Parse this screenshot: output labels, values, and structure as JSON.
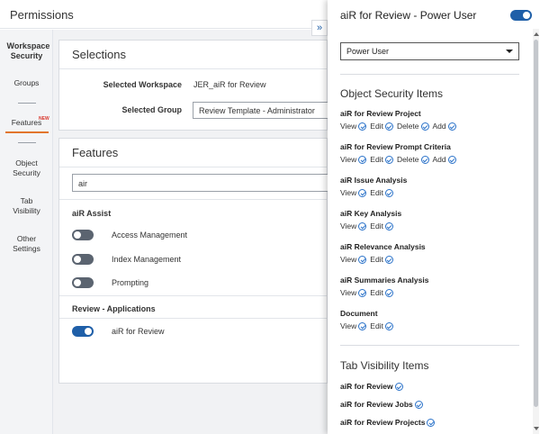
{
  "app": {
    "title": "Permissions"
  },
  "nav": {
    "workspace_security": "Workspace Security",
    "groups": "Groups",
    "features": "Features",
    "new_badge": "NEW",
    "object_security": "Object Security",
    "tab_visibility": "Tab Visibility",
    "other_settings": "Other Settings"
  },
  "selections": {
    "title": "Selections",
    "workspace_label": "Selected Workspace",
    "workspace_value": "JER_aiR for Review",
    "group_label": "Selected Group",
    "group_value": "Review Template - Administrator"
  },
  "features": {
    "title": "Features",
    "search_value": "air",
    "sections": [
      {
        "name": "aiR Assist",
        "items": [
          {
            "label": "Access Management",
            "enabled": false
          },
          {
            "label": "Index Management",
            "enabled": false
          },
          {
            "label": "Prompting",
            "enabled": false
          }
        ]
      },
      {
        "name": "Review - Applications",
        "items": [
          {
            "label": "aiR for Review",
            "enabled": true
          }
        ]
      }
    ]
  },
  "panel": {
    "title": "aiR for Review - Power User",
    "enabled": true,
    "role_value": "Power User",
    "object_heading": "Object Security Items",
    "object_items": [
      {
        "name": "aiR for Review Project",
        "perms": [
          "View",
          "Edit",
          "Delete",
          "Add"
        ]
      },
      {
        "name": "aiR for Review Prompt Criteria",
        "perms": [
          "View",
          "Edit",
          "Delete",
          "Add"
        ]
      },
      {
        "name": "aiR Issue Analysis",
        "perms": [
          "View",
          "Edit"
        ]
      },
      {
        "name": "aiR Key Analysis",
        "perms": [
          "View",
          "Edit"
        ]
      },
      {
        "name": "aiR Relevance Analysis",
        "perms": [
          "View",
          "Edit"
        ]
      },
      {
        "name": "aiR Summaries Analysis",
        "perms": [
          "View",
          "Edit"
        ]
      },
      {
        "name": "Document",
        "perms": [
          "View",
          "Edit"
        ]
      }
    ],
    "tab_heading": "Tab Visibility Items",
    "tab_items": [
      "aiR for Review",
      "aiR for Review Jobs",
      "aiR for Review Projects"
    ]
  },
  "colors": {
    "accent": "#1f5fa8",
    "active_tab": "#e2762c",
    "new_badge": "#d9352b"
  }
}
